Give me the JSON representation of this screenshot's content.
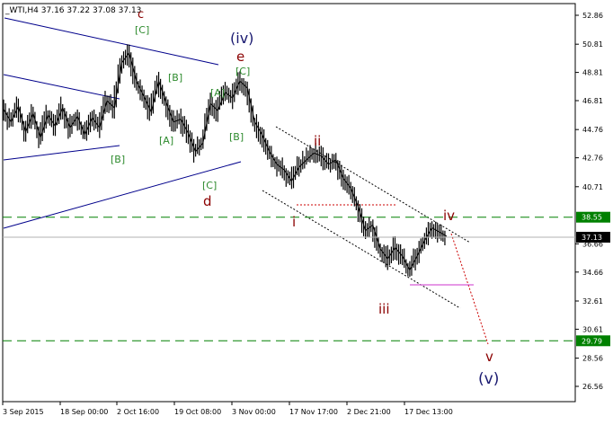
{
  "header": {
    "text": "_WTI,H4  37.16 37.22 37.08 37.13"
  },
  "chart_data": {
    "type": "candlestick",
    "symbol": "WTI",
    "timeframe": "H4",
    "ohlc": {
      "open": 37.16,
      "high": 37.22,
      "low": 37.08,
      "close": 37.13
    },
    "y_ticks": [
      "52.86",
      "50.81",
      "48.81",
      "46.81",
      "44.76",
      "42.76",
      "40.71",
      "38.55",
      "37.13",
      "36.66",
      "34.66",
      "32.61",
      "30.61",
      "29.79",
      "28.56",
      "26.56"
    ],
    "y_tick_values": [
      52.86,
      50.81,
      48.81,
      46.81,
      44.76,
      42.76,
      40.71,
      38.66,
      36.66,
      34.66,
      32.61,
      30.61,
      28.56,
      26.56
    ],
    "ylim": [
      26.0,
      53.8
    ],
    "x_ticks": [
      "3 Sep 2015",
      "18 Sep 00:00",
      "2 Oct 16:00",
      "19 Oct 08:00",
      "3 Nov 00:00",
      "17 Nov 17:00",
      "2 Dec 21:00",
      "17 Dec 13:00"
    ],
    "current_price": {
      "value": 37.13,
      "label": "37.13"
    },
    "levels": [
      {
        "value": 38.55,
        "label": "38.55",
        "color": "#008000",
        "style": "dashed"
      },
      {
        "value": 29.79,
        "label": "29.79",
        "color": "#008000",
        "style": "dashed"
      }
    ],
    "wave_labels": [
      {
        "text": "c",
        "color": "#8b0000"
      },
      {
        "text": "[C]",
        "color": "#2e8b2e"
      },
      {
        "text": "[B]",
        "color": "#2e8b2e"
      },
      {
        "text": "[A]",
        "color": "#2e8b2e"
      },
      {
        "text": "[B]",
        "color": "#2e8b2e"
      },
      {
        "text": "(iv)",
        "color": "#191970"
      },
      {
        "text": "e",
        "color": "#8b0000"
      },
      {
        "text": "[C]",
        "color": "#2e8b2e"
      },
      {
        "text": "[A]",
        "color": "#2e8b2e"
      },
      {
        "text": "[B]",
        "color": "#2e8b2e"
      },
      {
        "text": "[C]",
        "color": "#2e8b2e"
      },
      {
        "text": "d",
        "color": "#8b0000"
      },
      {
        "text": "ii",
        "color": "#8b0000"
      },
      {
        "text": "i",
        "color": "#8b0000"
      },
      {
        "text": "iii",
        "color": "#8b0000"
      },
      {
        "text": "iv",
        "color": "#8b0000"
      },
      {
        "text": "v",
        "color": "#8b0000"
      },
      {
        "text": "(v)",
        "color": "#191970"
      }
    ],
    "price_path": [
      [
        "3 Sep 2015",
        46.2
      ],
      [
        "5 Sep",
        45.3
      ],
      [
        "7 Sep",
        46.4
      ],
      [
        "9 Sep",
        44.6
      ],
      [
        "11 Sep",
        45.9
      ],
      [
        "13 Sep",
        44.2
      ],
      [
        "15 Sep",
        45.8
      ],
      [
        "17 Sep",
        45.0
      ],
      [
        "19 Sep",
        46.3
      ],
      [
        "21 Sep",
        44.9
      ],
      [
        "23 Sep",
        45.7
      ],
      [
        "25 Sep",
        44.4
      ],
      [
        "27 Sep",
        45.6
      ],
      [
        "29 Sep",
        44.9
      ],
      [
        "1 Oct",
        46.8
      ],
      [
        "2 Oct",
        46.3
      ],
      [
        "3 Oct",
        49.5
      ],
      [
        "4 Oct",
        50.2
      ],
      [
        "5 Oct",
        48.2
      ],
      [
        "7 Oct",
        47.1
      ],
      [
        "9 Oct",
        46.0
      ],
      [
        "11 Oct",
        48.2
      ],
      [
        "13 Oct",
        46.7
      ],
      [
        "15 Oct",
        45.3
      ],
      [
        "17 Oct",
        45.5
      ],
      [
        "19 Oct",
        44.5
      ],
      [
        "21 Oct",
        43.2
      ],
      [
        "22 Oct",
        43.8
      ],
      [
        "24 Oct",
        46.6
      ],
      [
        "26 Oct",
        46.1
      ],
      [
        "28 Oct",
        47.4
      ],
      [
        "30 Oct",
        47.0
      ],
      [
        "31 Oct",
        48.2
      ],
      [
        "2 Nov",
        47.7
      ],
      [
        "4 Nov",
        45.3
      ],
      [
        "6 Nov",
        44.4
      ],
      [
        "8 Nov",
        43.2
      ],
      [
        "10 Nov",
        42.3
      ],
      [
        "12 Nov",
        41.9
      ],
      [
        "14 Nov",
        41.1
      ],
      [
        "16 Nov",
        42.1
      ],
      [
        "18 Nov",
        42.6
      ],
      [
        "20 Nov",
        43.1
      ],
      [
        "22 Nov",
        42.9
      ],
      [
        "24 Nov",
        42.3
      ],
      [
        "26 Nov",
        42.6
      ],
      [
        "28 Nov",
        41.3
      ],
      [
        "30 Nov",
        40.6
      ],
      [
        "2 Dec",
        39.3
      ],
      [
        "4 Dec",
        37.6
      ],
      [
        "6 Dec",
        38.0
      ],
      [
        "8 Dec",
        36.3
      ],
      [
        "10 Dec",
        35.6
      ],
      [
        "12 Dec",
        36.4
      ],
      [
        "14 Dec",
        35.8
      ],
      [
        "16 Dec",
        34.8
      ],
      [
        "18 Dec",
        35.8
      ],
      [
        "20 Dec",
        36.9
      ],
      [
        "22 Dec",
        37.8
      ],
      [
        "24 Dec",
        37.5
      ],
      [
        "26 Dec",
        37.2
      ]
    ],
    "colors": {
      "candles": "#000000",
      "channel_lines": "#00008b",
      "wave_channel": "#000000",
      "projection": "#cc0000",
      "horizontal_level": "#cc33cc",
      "support_resistance": "#008000",
      "price_marker_bg": "#000000"
    }
  }
}
